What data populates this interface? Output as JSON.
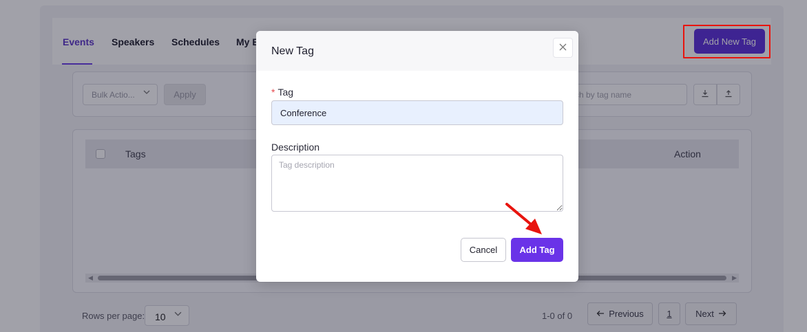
{
  "tabs": [
    {
      "label": "Events",
      "active": true
    },
    {
      "label": "Speakers",
      "active": false
    },
    {
      "label": "Schedules",
      "active": false
    },
    {
      "label": "My E",
      "active": false
    }
  ],
  "header": {
    "add_new_tag_label": "Add New Tag"
  },
  "toolbar": {
    "bulk_action_label": "Bulk Actio...",
    "apply_label": "Apply",
    "search_placeholder": "rch by tag name"
  },
  "table": {
    "columns": [
      "Tags",
      "Action"
    ]
  },
  "pagination": {
    "rows_per_page_label": "Rows per page:",
    "rows_per_page_value": "10",
    "range_text": "1-0 of 0",
    "previous_label": "Previous",
    "page_number": "1",
    "next_label": "Next"
  },
  "modal": {
    "title": "New Tag",
    "tag_label": "Tag",
    "required_mark": "*",
    "tag_value": "Conference",
    "description_label": "Description",
    "description_placeholder": "Tag description",
    "cancel_label": "Cancel",
    "submit_label": "Add Tag"
  },
  "colors": {
    "accent": "#6a33e8",
    "annotation": "#e8140e"
  },
  "icons": {
    "close": "close-icon",
    "download": "download-icon",
    "upload": "upload-icon",
    "chevron": "chevron-down-icon",
    "arrow_left": "arrow-left-icon",
    "arrow_right": "arrow-right-icon"
  }
}
